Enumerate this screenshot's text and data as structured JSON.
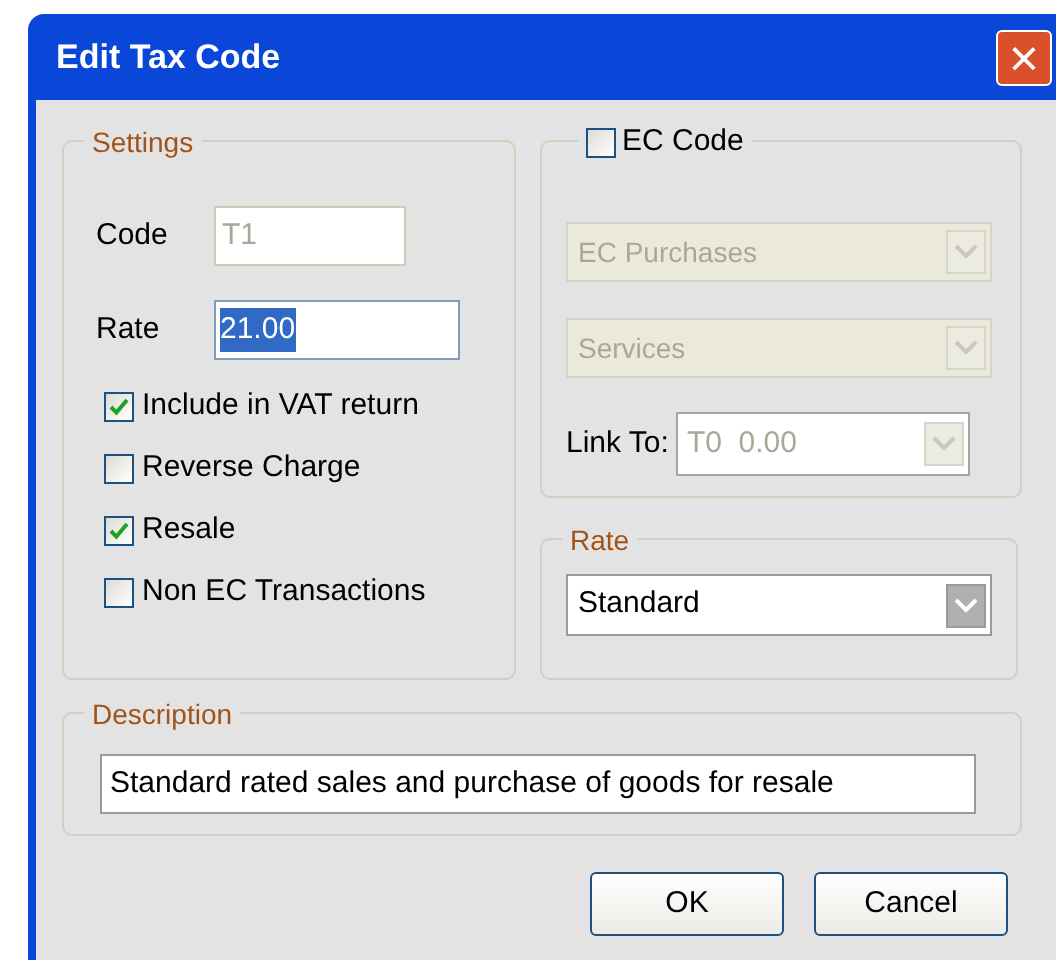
{
  "window": {
    "title": "Edit Tax Code",
    "close": "×"
  },
  "settings": {
    "title": "Settings",
    "code": {
      "label": "Code",
      "value": "T1",
      "disabled": true
    },
    "rate": {
      "label": "Rate",
      "value": "21.00",
      "selected": true
    },
    "options": [
      {
        "label": "Include in VAT return",
        "checked": true
      },
      {
        "label": "Reverse Charge",
        "checked": false
      },
      {
        "label": "Resale",
        "checked": true
      },
      {
        "label": "Non EC Transactions",
        "checked": false
      }
    ]
  },
  "ec": {
    "label": "EC Code",
    "checked": false,
    "dropdowns": [
      {
        "value": "EC Purchases",
        "disabled": true
      },
      {
        "value": "Services",
        "disabled": true
      }
    ],
    "link_to": {
      "label": "Link To:",
      "value": "T0  0.00",
      "disabled": true
    }
  },
  "rate_group": {
    "title": "Rate",
    "value": "Standard"
  },
  "description": {
    "title": "Description",
    "value": "Standard rated sales and purchase of goods for resale"
  },
  "buttons": [
    {
      "label": "OK"
    },
    {
      "label": "Cancel"
    }
  ]
}
